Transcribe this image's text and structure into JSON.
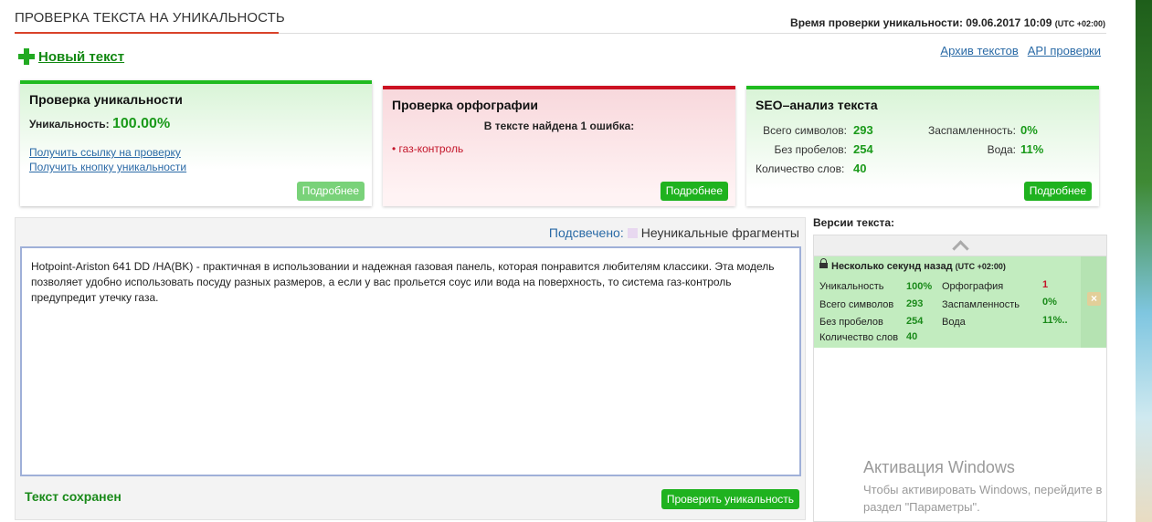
{
  "header": {
    "title": "ПРОВЕРКА ТЕКСТА НА УНИКАЛЬНОСТЬ",
    "check_time_label": "Время проверки уникальности:",
    "check_time_value": "09.06.2017 10:09",
    "timezone": "(UTC +02:00)",
    "new_text": "Новый текст",
    "archive_link": "Архив текстов",
    "api_link": "API проверки"
  },
  "uniqueness_card": {
    "title": "Проверка уникальности",
    "label": "Уникальность:",
    "value": "100.00%",
    "link_check": "Получить ссылку на проверку",
    "link_button": "Получить кнопку уникальности",
    "more": "Подробнее"
  },
  "spelling_card": {
    "title": "Проверка орфографии",
    "found": "В тексте найдена 1 ошибка:",
    "errors": [
      "газ-контроль"
    ],
    "more": "Подробнее"
  },
  "seo_card": {
    "title": "SEO–анализ текста",
    "total_chars_label": "Всего символов:",
    "total_chars": "293",
    "no_spaces_label": "Без пробелов:",
    "no_spaces": "254",
    "words_label": "Количество слов:",
    "words": "40",
    "spam_label": "Заспамленность:",
    "spam": "0%",
    "water_label": "Вода:",
    "water": "11%",
    "more": "Подробнее"
  },
  "editor": {
    "highlight_prefix": "Подсвечено:",
    "highlight_legend": "Неуникальные фрагменты",
    "text": "Hotpoint-Ariston 641 DD /HA(BK) - практичная в использовании и надежная газовая панель, которая понравится любителям классики. Эта модель позволяет удобно использовать посуду разных размеров, а если у вас прольется соус или вода на поверхность, то система газ-контроль предупредит утечку газа.",
    "saved_status": "Текст сохранен",
    "check_button": "Проверить уникальность"
  },
  "versions": {
    "title": "Версии текста:",
    "items": [
      {
        "time": "Несколько секунд назад",
        "timezone": "(UTC +02:00)",
        "uniq_label": "Уникальность",
        "uniq": "100%",
        "spell_label": "Орфография",
        "spell": "1",
        "chars_label": "Всего символов",
        "chars": "293",
        "spam_label": "Заспамленность",
        "spam": "0%",
        "nospace_label": "Без пробелов",
        "nospace": "254",
        "water_label": "Вода",
        "water": "11%..",
        "words_label": "Количество слов",
        "words": "40",
        "close": "×"
      }
    ]
  },
  "watermark": {
    "title": "Активация Windows",
    "line1": "Чтобы активировать Windows, перейдите в",
    "line2": "раздел \"Параметры\"."
  },
  "colors": {
    "accent_green": "#1fb21f",
    "error_red": "#cc1122",
    "link_blue": "#2a6aa6"
  }
}
